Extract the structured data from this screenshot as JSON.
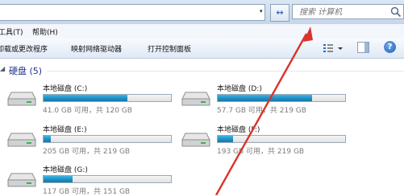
{
  "address_bar": {
    "dropdown_glyph": "▾",
    "refresh_glyph": "↔"
  },
  "search": {
    "placeholder": "搜索 计算机"
  },
  "menu": {
    "items": [
      "工具(T)",
      "帮助(H)"
    ]
  },
  "command_bar": {
    "items": [
      "卸载或更改程序",
      "映射网络驱动器",
      "打开控制面板"
    ],
    "help_glyph": "?"
  },
  "group": {
    "toggle": "◢",
    "title": "硬盘 (5)"
  },
  "drives": [
    {
      "name": "本地磁盘 (C:)",
      "free_text": "41.0 GB 可用，共 120 GB",
      "used_fraction": 0.66
    },
    {
      "name": "本地磁盘 (D:)",
      "free_text": "57.7 GB 可用，共 219 GB",
      "used_fraction": 0.74
    },
    {
      "name": "本地磁盘 (E:)",
      "free_text": "205 GB 可用，共 219 GB",
      "used_fraction": 0.06
    },
    {
      "name": "本地磁盘 (F:)",
      "free_text": "193 GB 可用，共 219 GB",
      "used_fraction": 0.12
    },
    {
      "name": "本地磁盘 (G:)",
      "free_text": "117 GB 可用，共 151 GB",
      "used_fraction": 0.23
    }
  ],
  "colors": {
    "annotation_arrow": "#d9342b",
    "usage_bar": "#1e8fc4",
    "group_title": "#1e3287"
  }
}
